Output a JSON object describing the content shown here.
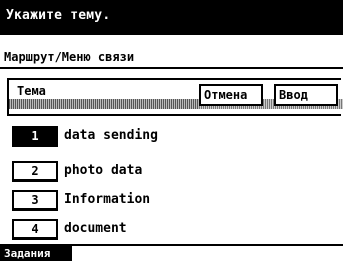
{
  "header": {
    "title": "Укажите тему."
  },
  "route": {
    "label": "Маршрут/Меню связи"
  },
  "subject": {
    "label": "Тема",
    "cancel_label": "Отмена",
    "enter_label": "Ввод"
  },
  "items": [
    {
      "number": "1",
      "label": "data sending",
      "selected": true
    },
    {
      "number": "2",
      "label": "photo data",
      "selected": false
    },
    {
      "number": "3",
      "label": "Information",
      "selected": false
    },
    {
      "number": "4",
      "label": "document",
      "selected": false
    }
  ],
  "tabs": {
    "jobs_label": "Задания"
  }
}
